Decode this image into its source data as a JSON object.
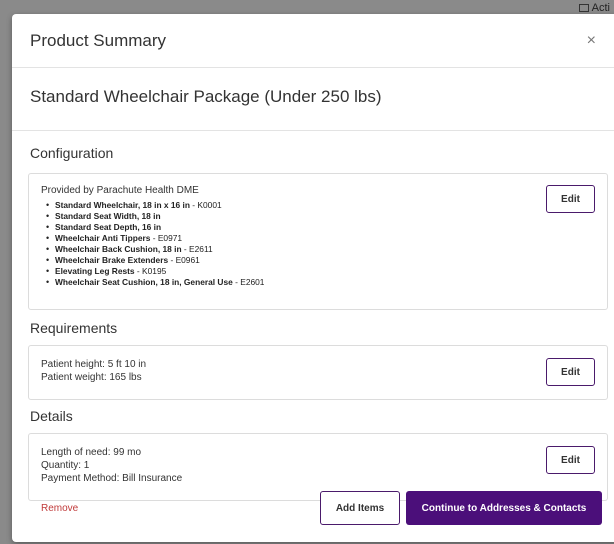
{
  "backdrop": {
    "tray_text": "Acti"
  },
  "modal": {
    "title": "Product Summary",
    "close_glyph": "×",
    "package_title": "Standard Wheelchair Package (Under 250 lbs)"
  },
  "configuration": {
    "heading": "Configuration",
    "provider": "Provided by Parachute Health DME",
    "items": [
      {
        "name": "Standard Wheelchair, 18 in x 16 in",
        "code": " - K0001"
      },
      {
        "name": "Standard Seat Width, 18 in",
        "code": ""
      },
      {
        "name": "Standard Seat Depth, 16 in",
        "code": ""
      },
      {
        "name": "Wheelchair Anti Tippers",
        "code": " - E0971"
      },
      {
        "name": "Wheelchair Back Cushion, 18 in",
        "code": " - E2611"
      },
      {
        "name": "Wheelchair Brake Extenders",
        "code": " - E0961"
      },
      {
        "name": "Elevating Leg Rests",
        "code": " - K0195"
      },
      {
        "name": "Wheelchair Seat Cushion, 18 in, General Use",
        "code": " - E2601"
      }
    ],
    "edit_label": "Edit"
  },
  "requirements": {
    "heading": "Requirements",
    "lines": [
      "Patient height: 5 ft 10 in",
      "Patient weight: 165 lbs"
    ],
    "edit_label": "Edit"
  },
  "details": {
    "heading": "Details",
    "lines": [
      "Length of need: 99 mo",
      "Quantity: 1",
      "Payment Method: Bill Insurance"
    ],
    "edit_label": "Edit"
  },
  "footer": {
    "remove_label": "Remove",
    "add_items_label": "Add Items",
    "continue_label": "Continue to Addresses & Contacts"
  },
  "colors": {
    "accent": "#4b0f7a",
    "remove": "#c03a3a"
  }
}
